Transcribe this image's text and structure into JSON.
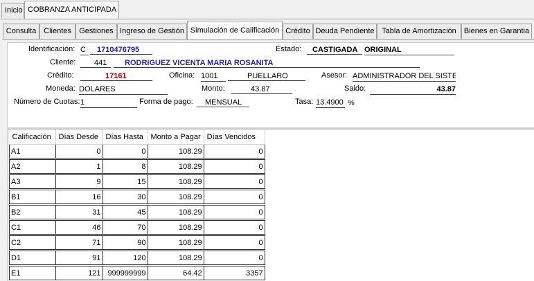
{
  "top_tabs": [
    {
      "label": "Inicio"
    },
    {
      "label": "COBRANZA ANTICIPADA"
    }
  ],
  "sub_tabs": [
    {
      "label": "Consulta"
    },
    {
      "label": "Clientes"
    },
    {
      "label": "Gestiones"
    },
    {
      "label": "Ingreso de Gestión"
    },
    {
      "label": "Simulación de Calificación"
    },
    {
      "label": "Crédito"
    },
    {
      "label": "Deuda Pendiente"
    },
    {
      "label": "Tabla de Amortización"
    },
    {
      "label": "Bienes en Garantia"
    }
  ],
  "form": {
    "identificacion_label": "Identificación:",
    "identificacion_tipo": "C",
    "identificacion_valor": "1710476795",
    "estado_label": "Estado:",
    "estado_valor": "CASTIGADA",
    "estado_origen": "ORIGINAL",
    "cliente_label": "Cliente:",
    "cliente_codigo": "441",
    "cliente_nombre": "RODRIGUEZ VICENTA MARIA ROSANITA",
    "credito_label": "Crédito:",
    "credito_valor": "17161",
    "oficina_label": "Oficina:",
    "oficina_codigo": "1001",
    "oficina_nombre": "PUELLARO",
    "asesor_label": "Asesor:",
    "asesor_valor": "ADMINISTRADOR DEL SISTEMA",
    "moneda_label": "Moneda:",
    "moneda_valor": "DOLARES",
    "monto_label": "Monto:",
    "monto_valor": "43.87",
    "saldo_label": "Saldo:",
    "saldo_valor": "43.87",
    "cuotas_label": "Número de Cuotas:",
    "cuotas_valor": "1",
    "forma_pago_label": "Forma de pago:",
    "forma_pago_valor": "MENSUAL",
    "tasa_label": "Tasa:",
    "tasa_valor": "13.4900",
    "tasa_unidad": "%"
  },
  "grid": {
    "headers": [
      "Calificación",
      "Días Desde",
      "Días Hasta",
      "Monto a Pagar",
      "Días Vencidos"
    ],
    "rows": [
      [
        "A1",
        "0",
        "0",
        "108.29",
        "0"
      ],
      [
        "A2",
        "1",
        "8",
        "108.29",
        "0"
      ],
      [
        "A3",
        "9",
        "15",
        "108.29",
        "0"
      ],
      [
        "B1",
        "16",
        "30",
        "108.29",
        "0"
      ],
      [
        "B2",
        "31",
        "45",
        "108.29",
        "0"
      ],
      [
        "C1",
        "46",
        "70",
        "108.29",
        "0"
      ],
      [
        "C2",
        "71",
        "90",
        "108.29",
        "0"
      ],
      [
        "D1",
        "91",
        "120",
        "108.29",
        "0"
      ],
      [
        "E1",
        "121",
        "999999999",
        "64.42",
        "3357"
      ]
    ]
  }
}
